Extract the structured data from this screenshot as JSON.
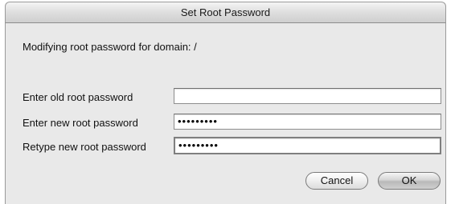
{
  "dialog": {
    "title": "Set Root Password",
    "message": "Modifying root password for domain: /"
  },
  "fields": {
    "old_password": {
      "label": "Enter old root password",
      "value": ""
    },
    "new_password": {
      "label": "Enter new root password",
      "value": "•••••••••"
    },
    "retype_password": {
      "label": "Retype new root password",
      "value": "•••••••••"
    }
  },
  "buttons": {
    "cancel": "Cancel",
    "ok": "OK"
  }
}
